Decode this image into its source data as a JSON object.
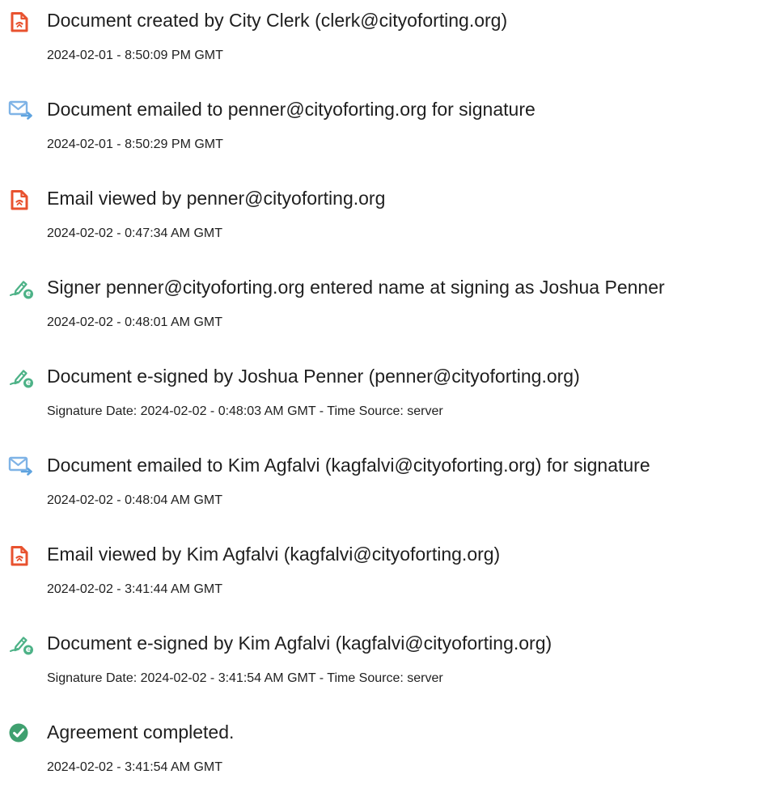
{
  "colors": {
    "text": "#1f1f1f",
    "document_icon": "#e8522f",
    "email_icon": "#7fb3e6",
    "signature_icon": "#4db287",
    "complete_icon": "#3fa06f"
  },
  "events": [
    {
      "icon": "document-icon",
      "title": "Document created by City Clerk (clerk@cityoforting.org)",
      "timestamp": "2024-02-01 - 8:50:09 PM GMT"
    },
    {
      "icon": "email-icon",
      "title": "Document emailed to penner@cityoforting.org for signature",
      "timestamp": "2024-02-01 - 8:50:29 PM GMT"
    },
    {
      "icon": "document-icon",
      "title": "Email viewed by penner@cityoforting.org",
      "timestamp": "2024-02-02 - 0:47:34 AM GMT"
    },
    {
      "icon": "signature-icon",
      "title": "Signer penner@cityoforting.org entered name at signing as Joshua Penner",
      "timestamp": "2024-02-02 - 0:48:01 AM GMT"
    },
    {
      "icon": "signature-icon",
      "title": "Document e-signed by Joshua Penner (penner@cityoforting.org)",
      "timestamp": "Signature Date: 2024-02-02 - 0:48:03 AM GMT - Time Source: server"
    },
    {
      "icon": "email-icon",
      "title": "Document emailed to Kim Agfalvi (kagfalvi@cityoforting.org) for signature",
      "timestamp": "2024-02-02 - 0:48:04 AM GMT"
    },
    {
      "icon": "document-icon",
      "title": "Email viewed by Kim Agfalvi (kagfalvi@cityoforting.org)",
      "timestamp": "2024-02-02 - 3:41:44 AM GMT"
    },
    {
      "icon": "signature-icon",
      "title": "Document e-signed by Kim Agfalvi (kagfalvi@cityoforting.org)",
      "timestamp": "Signature Date: 2024-02-02 - 3:41:54 AM GMT - Time Source: server"
    },
    {
      "icon": "check-circle-icon",
      "title": "Agreement completed.",
      "timestamp": "2024-02-02 - 3:41:54 AM GMT"
    }
  ]
}
